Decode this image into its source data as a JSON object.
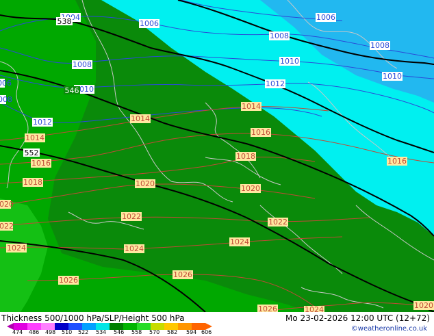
{
  "map": {
    "slp_labels_blue": [
      "1004",
      "1006",
      "1006",
      "1008",
      "1008",
      "1008",
      "1010",
      "1010",
      "1010",
      "1012",
      "1012",
      "1006",
      "1008"
    ],
    "slp_labels_red": [
      "1014",
      "1014",
      "1014",
      "1016",
      "1016",
      "1016",
      "1018",
      "1018",
      "1020",
      "1020",
      "1020",
      "1022",
      "1022",
      "1022",
      "1024",
      "1024",
      "1024",
      "1026",
      "1026",
      "1026",
      "1024",
      "1020"
    ],
    "height_labels": [
      "538",
      "546",
      "552"
    ],
    "colors": {
      "deep_sky": "#22b8f0",
      "cyan": "#00f0f0",
      "dark_green": "#0a8a0a",
      "mid_green": "#00a800",
      "light_green": "#14c014",
      "slp_blue_line": "#2a4ad8",
      "slp_red_line": "#c04a36",
      "height_line": "#000000",
      "coast_line": "#c8c8c8"
    }
  },
  "footer": {
    "title": "Thickness 500/1000 hPa/SLP/Height 500 hPa",
    "datetime": "Mo 23-02-2026 12:00 UTC (12+72)",
    "credit": "©weatheronline.co.uk",
    "legend_ticks": [
      "474",
      "486",
      "498",
      "510",
      "522",
      "534",
      "546",
      "558",
      "570",
      "582",
      "594",
      "606"
    ],
    "legend_colors": [
      "#b000b0",
      "#e000e0",
      "#0000c8",
      "#1e50ff",
      "#00a0ff",
      "#00e6e6",
      "#008000",
      "#00b400",
      "#28dc28",
      "#c8dc00",
      "#ffc800",
      "#ff9600",
      "#ff6400"
    ]
  }
}
